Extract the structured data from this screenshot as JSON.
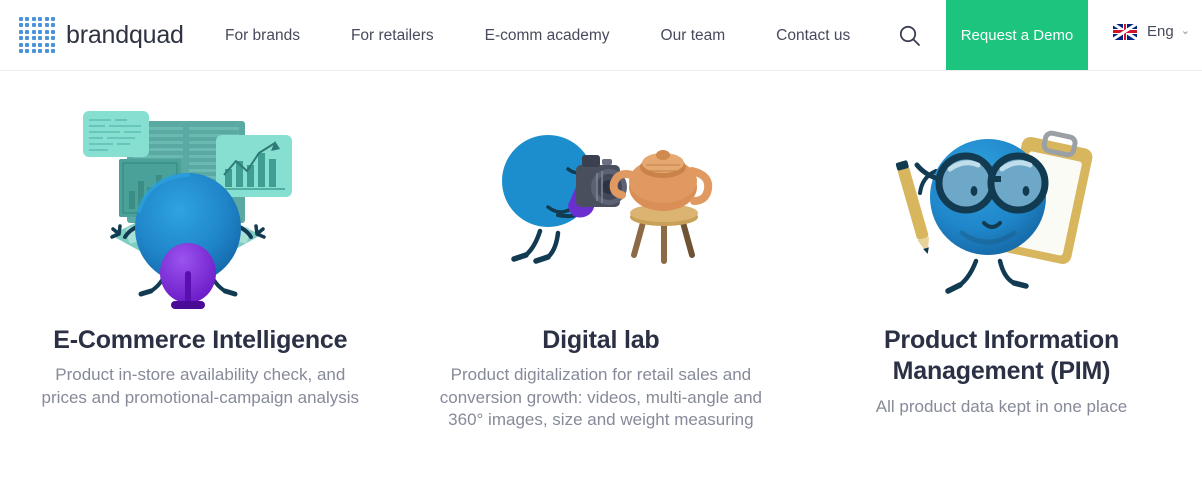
{
  "header": {
    "logo": {
      "text": "brandquad",
      "icon": "dot-grid-logo-icon",
      "dots": 36,
      "color": "#4a93dd"
    },
    "nav_items": [
      {
        "label": "For brands"
      },
      {
        "label": "For retailers"
      },
      {
        "label": "E-comm academy"
      },
      {
        "label": "Our team"
      },
      {
        "label": "Contact us"
      }
    ],
    "search": {
      "icon": "search-icon"
    },
    "cta": {
      "label": "Request a Demo",
      "color": "#1cc47e"
    },
    "language": {
      "label": "Eng",
      "flag_icon": "uk-flag-icon",
      "chevron_icon": "chevron-down-icon",
      "chevron_glyph": "⌄"
    }
  },
  "cards": [
    {
      "illustration": "ecommerce-intelligence-illustration",
      "title": "E-Commerce Intelligence",
      "description": "Product in-store availability check, and prices and promotional-campaign analysis"
    },
    {
      "illustration": "digital-lab-illustration",
      "title": "Digital lab",
      "description": "Product digitalization for retail sales and conversion growth: videos, multi-angle and 360° images, size and weight measuring"
    },
    {
      "illustration": "product-information-management-illustration",
      "title": "Product Information Management (PIM)",
      "description": "All product data kept in one place"
    }
  ],
  "colors": {
    "accent_green": "#1cc47e",
    "brand_blue": "#2190ce",
    "logo_blue": "#4a93dd",
    "heading": "#2b3044",
    "body_text": "#868a99",
    "nav_text": "#464a5c",
    "teal": "#7fd9cc",
    "purple": "#7a30d8",
    "gold": "#d9b758"
  }
}
